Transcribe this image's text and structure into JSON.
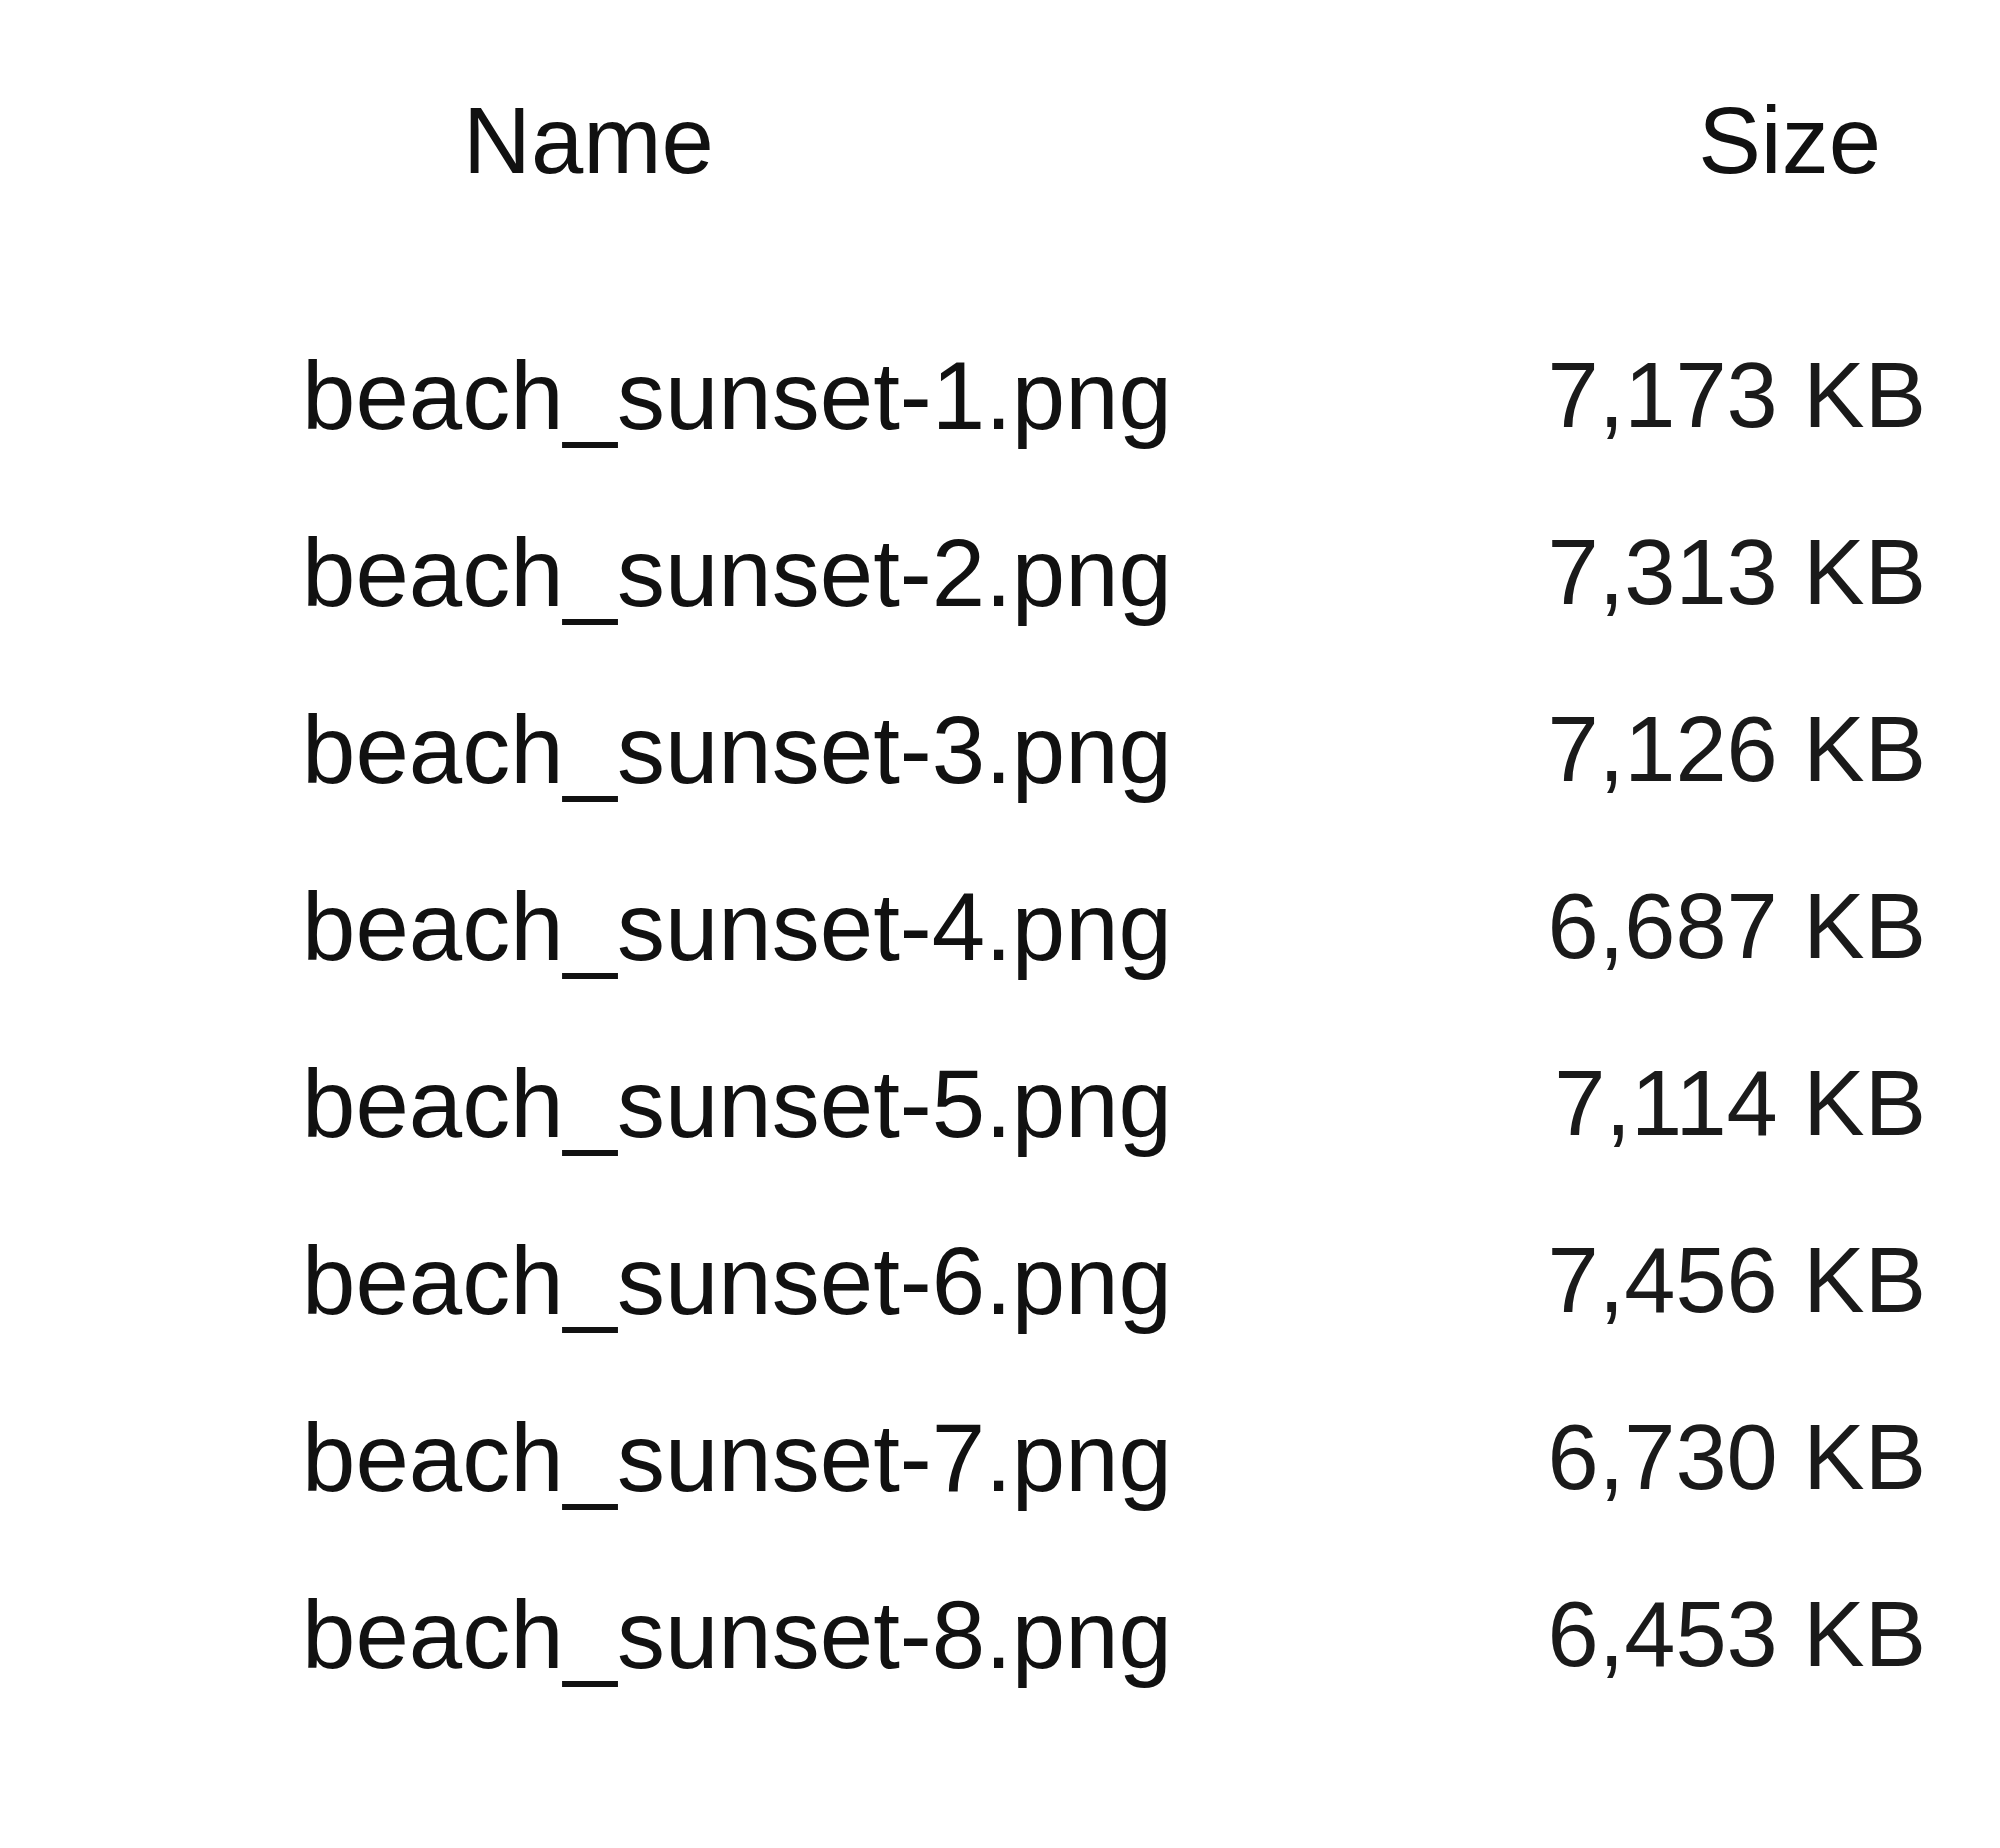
{
  "columns": [
    "Name",
    "Size"
  ],
  "rows": [
    {
      "name": "beach_sunset-1.png",
      "size": "7,173 KB"
    },
    {
      "name": "beach_sunset-2.png",
      "size": "7,313 KB"
    },
    {
      "name": "beach_sunset-3.png",
      "size": "7,126 KB"
    },
    {
      "name": "beach_sunset-4.png",
      "size": "6,687 KB"
    },
    {
      "name": "beach_sunset-5.png",
      "size": "7,114 KB"
    },
    {
      "name": "beach_sunset-6.png",
      "size": "7,456 KB"
    },
    {
      "name": "beach_sunset-7.png",
      "size": "6,730 KB"
    },
    {
      "name": "beach_sunset-8.png",
      "size": "6,453 KB"
    }
  ]
}
